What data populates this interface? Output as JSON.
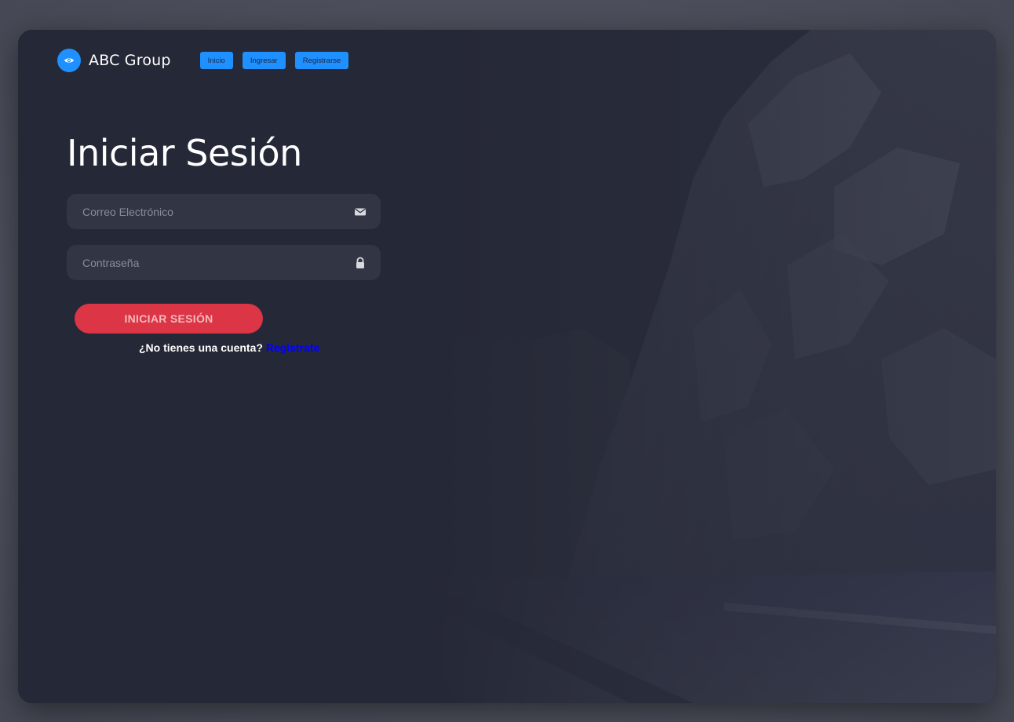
{
  "brand": {
    "name": "ABC Group",
    "icon": "eye-icon",
    "color": "#1e90ff"
  },
  "nav": {
    "items": [
      {
        "label": "Inicio"
      },
      {
        "label": "Ingresar"
      },
      {
        "label": "Registrarse"
      }
    ]
  },
  "login": {
    "title": "Iniciar Sesión",
    "email_placeholder": "Correo Electrónico",
    "email_icon": "envelope-icon",
    "password_placeholder": "Contraseña",
    "password_icon": "lock-icon",
    "submit_label": "INICIAR SESIÓN",
    "signup_prompt": "¿No tienes una cuenta?",
    "signup_link": "Registrate"
  },
  "colors": {
    "background": "#252836",
    "input": "#323543",
    "accent": "#1e90ff",
    "submit": "#dc3545",
    "link": "#0000ff"
  }
}
